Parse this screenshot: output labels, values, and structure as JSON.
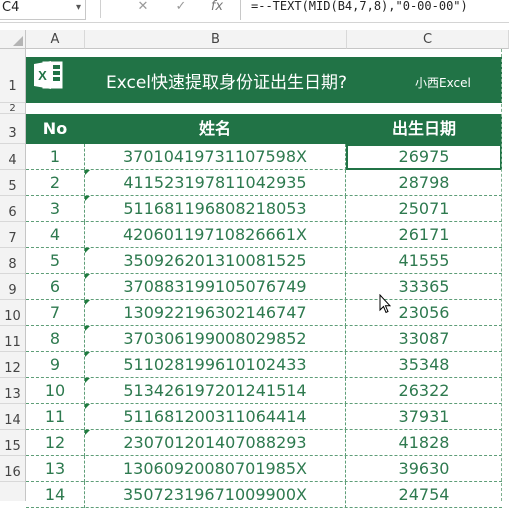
{
  "formula_bar": {
    "name_box": "C4",
    "dropdown_glyph": "▾",
    "cancel_glyph": "✕",
    "enter_glyph": "✓",
    "fx_glyph": "fx",
    "formula": "=--TEXT(MID(B4,7,8),\"0-00-00\")"
  },
  "columns": [
    "A",
    "B",
    "C"
  ],
  "row_numbers": [
    "1",
    "2",
    "3",
    "4",
    "5",
    "6",
    "7",
    "8",
    "9",
    "10",
    "11",
    "12",
    "13",
    "14",
    "15",
    "16"
  ],
  "banner": {
    "title": "Excel快速提取身份证出生日期?",
    "brand": "小西Excel",
    "logo_letter": "X"
  },
  "table": {
    "headers": [
      "No",
      "姓名",
      "出生日期"
    ],
    "rows": [
      {
        "no": "1",
        "id": "37010419731107598X",
        "date": "26975",
        "flag": false
      },
      {
        "no": "2",
        "id": "411523197811042935",
        "date": "28798",
        "flag": true
      },
      {
        "no": "3",
        "id": "511681196808218053",
        "date": "25071",
        "flag": true
      },
      {
        "no": "4",
        "id": "42060119710826661X",
        "date": "26171",
        "flag": false
      },
      {
        "no": "5",
        "id": "350926201310081525",
        "date": "41555",
        "flag": true
      },
      {
        "no": "6",
        "id": "370883199105076749",
        "date": "33365",
        "flag": true
      },
      {
        "no": "7",
        "id": "130922196302146747",
        "date": "23056",
        "flag": true
      },
      {
        "no": "8",
        "id": "370306199008029852",
        "date": "33087",
        "flag": true
      },
      {
        "no": "9",
        "id": "511028199610102433",
        "date": "35348",
        "flag": true
      },
      {
        "no": "10",
        "id": "513426197201241514",
        "date": "26322",
        "flag": true
      },
      {
        "no": "11",
        "id": "511681200311064414",
        "date": "37931",
        "flag": true
      },
      {
        "no": "12",
        "id": "230701201407088293",
        "date": "41828",
        "flag": true
      },
      {
        "no": "13",
        "id": "13060920080701985X",
        "date": "39630",
        "flag": false
      },
      {
        "no": "14",
        "id": "35072319671009900X",
        "date": "24754",
        "flag": false
      }
    ]
  },
  "colors": {
    "header_green": "#217346",
    "text_green": "#2e7a4f"
  }
}
